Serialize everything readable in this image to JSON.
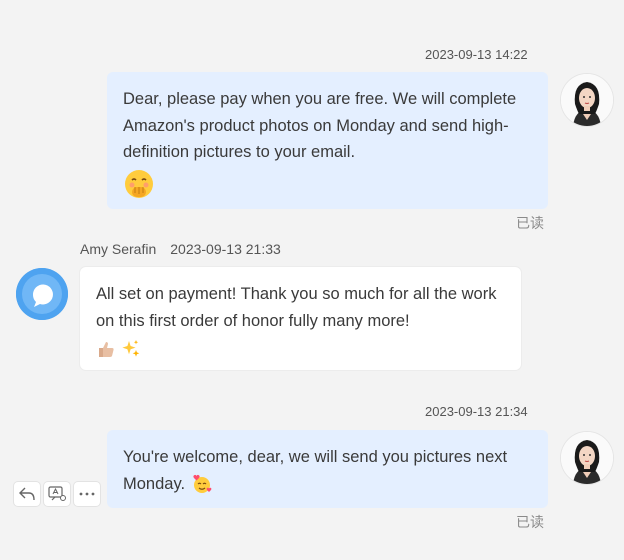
{
  "messages": [
    {
      "direction": "outgoing",
      "timestamp": "2023-09-13 14:22",
      "text": "Dear, please pay when you are free. We will complete Amazon's product photos on Monday and send high-definition pictures to your email.",
      "emoji": "hand-over-mouth-emoji",
      "read_status": "已读"
    },
    {
      "direction": "incoming",
      "sender": "Amy Serafin",
      "timestamp": "2023-09-13 21:33",
      "text": "All set on payment! Thank you so much for all the work on this first order of honor fully many more!",
      "emojis": [
        "thumbs-up-emoji",
        "sparkles-emoji"
      ]
    },
    {
      "direction": "outgoing",
      "timestamp": "2023-09-13 21:34",
      "text": "You're welcome, dear, we will send you pictures next Monday.",
      "emoji": "smiling-face-with-hearts-emoji",
      "read_status": "已读"
    }
  ],
  "message_actions": [
    "reply-icon",
    "translate-icon",
    "more-icon"
  ],
  "colors": {
    "background": "#f3f3f3",
    "outgoing_bubble": "#e4efff",
    "incoming_bubble": "#ffffff",
    "contact_avatar": "#4ea3f0"
  }
}
